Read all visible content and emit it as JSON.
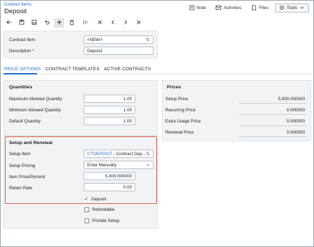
{
  "header": {
    "breadcrumb": "Contract Items",
    "title": "Deposit",
    "actions": [
      {
        "label": "Note",
        "icon": "note-icon"
      },
      {
        "label": "Activities",
        "icon": "mail-icon"
      },
      {
        "label": "Files",
        "icon": "file-icon"
      },
      {
        "label": "Tools",
        "icon": "gear-icon"
      }
    ]
  },
  "toolbar": {
    "buttons": [
      "back-icon",
      "save-close-icon",
      "save-icon",
      "undo-icon",
      "add-icon",
      "delete-icon",
      "copy-icon",
      "first-icon",
      "previous-icon",
      "next-icon",
      "last-icon"
    ]
  },
  "form": {
    "contract_item_label": "Contract Item",
    "contract_item_value": "<NEW>",
    "description_label": "Description *",
    "description_value": "Deposit"
  },
  "tabs": [
    "PRICE OPTIONS",
    "CONTRACT TEMPLATES",
    "ACTIVE CONTRACTS"
  ],
  "quantities": {
    "title": "Quantities",
    "rows": [
      {
        "label": "Maximum Allowed Quantity",
        "value": "1.00"
      },
      {
        "label": "Minimum Allowed Quantity",
        "value": "1.00"
      },
      {
        "label": "Default Quantity",
        "value": "1.00"
      }
    ]
  },
  "setup": {
    "title": "Setup and Renewal",
    "setup_item_label": "Setup Item",
    "setup_item_link": "CTDEPOSIT",
    "setup_item_rest": " - Contract Dep...",
    "setup_pricing_label": "Setup Pricing",
    "setup_pricing_value": "Enter Manually",
    "item_price_label": "Item Price/Percent",
    "item_price_value": "5,000.000000",
    "retain_rate_label": "Retain Rate",
    "retain_rate_value": "0.00",
    "deposit_label": "Deposit",
    "refundable_label": "Refundable",
    "prorate_label": "Prorate Setup"
  },
  "prices": {
    "title": "Prices",
    "rows": [
      {
        "label": "Setup Price",
        "value": "5,000.000000"
      },
      {
        "label": "Recurring Price",
        "value": "0.000000"
      },
      {
        "label": "Extra Usage Price",
        "value": "0.000000"
      },
      {
        "label": "Renewal Price",
        "value": "0.000000"
      }
    ]
  }
}
